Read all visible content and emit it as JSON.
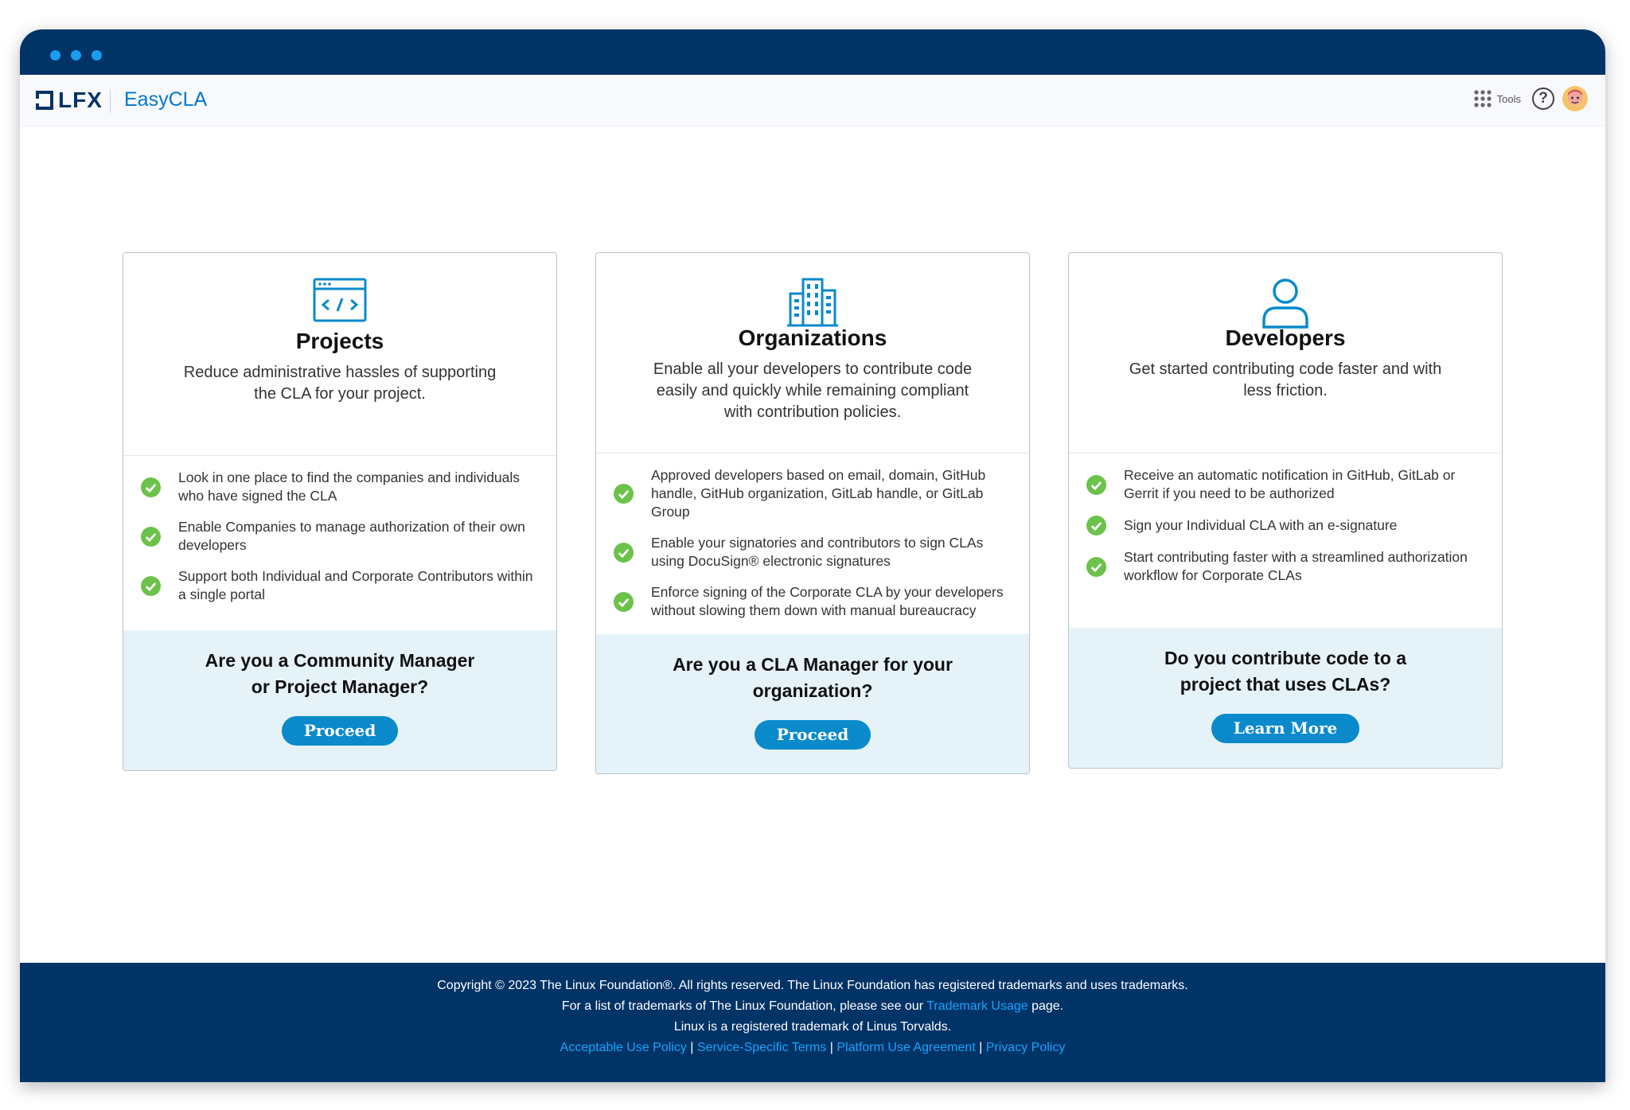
{
  "header": {
    "logo_text": "LFX",
    "app_name": "EasyCLA",
    "tools_label": "Tools",
    "help_symbol": "?"
  },
  "cards": [
    {
      "icon": "code-window-icon",
      "title": "Projects",
      "description": "Reduce administrative hassles of supporting the CLA for your project.",
      "features": [
        "Look in one place to find the companies and individuals who have signed the CLA",
        "Enable Companies to manage authorization of their own developers",
        "Support both Individual and Corporate Contributors within a single portal"
      ],
      "cta_title": "Are you a Community Manager or Project Manager?",
      "button_label": "Proceed"
    },
    {
      "icon": "building-icon",
      "title": "Organizations",
      "description": "Enable all your developers to contribute code easily and quickly while remaining compliant with contribution policies.",
      "features": [
        "Approved developers based on email, domain, GitHub handle, GitHub organization, GitLab handle, or GitLab Group",
        "Enable your signatories and contributors to sign CLAs using DocuSign® electronic signatures",
        "Enforce signing of the Corporate CLA by your developers without slowing them down with manual bureaucracy"
      ],
      "cta_title": "Are you a CLA Manager for your organization?",
      "button_label": "Proceed"
    },
    {
      "icon": "user-icon",
      "title": "Developers",
      "description": "Get started contributing code faster and with less friction.",
      "features": [
        "Receive an automatic notification in GitHub, GitLab or Gerrit if you need to be authorized",
        "Sign your Individual CLA with an e-signature",
        "Start contributing faster with a streamlined authorization workflow for Corporate CLAs"
      ],
      "cta_title": "Do you contribute code to a project that uses CLAs?",
      "button_label": "Learn More"
    }
  ],
  "footer": {
    "line1": "Copyright © 2023 The Linux Foundation®. All rights reserved. The Linux Foundation has registered trademarks and uses trademarks.",
    "line2_prefix": "For a list of trademarks of The Linux Foundation, please see our",
    "line2_link": "Trademark Usage",
    "line2_suffix": "page.",
    "line3": "Linux is a registered trademark of Linus Torvalds.",
    "links": [
      "Acceptable Use Policy",
      "Service-Specific Terms",
      "Platform Use Agreement",
      "Privacy Policy"
    ],
    "link_separator": "|"
  },
  "colors": {
    "navy": "#003366",
    "accent": "#0a8acb",
    "link": "#1aa3ff",
    "check": "#6cc24a",
    "cta_bg": "#e5f3f9"
  }
}
